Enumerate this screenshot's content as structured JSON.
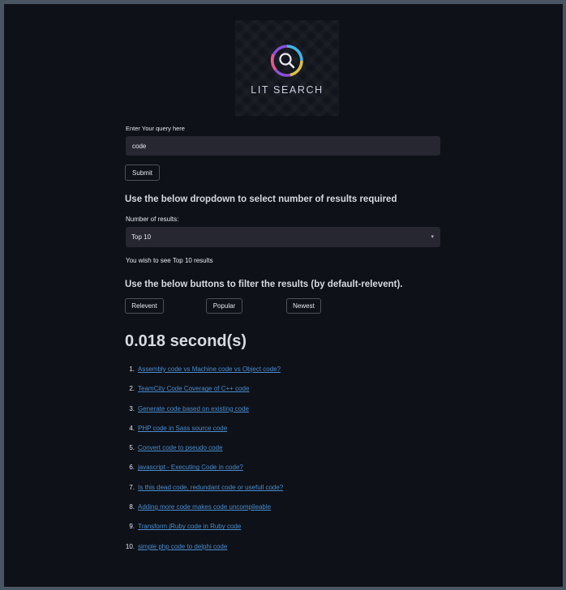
{
  "logo": {
    "text": "LIT SEARCH",
    "icon": "magnifier-icon"
  },
  "query": {
    "label": "Enter Your query here",
    "value": "code"
  },
  "submit_label": "Submit",
  "dropdown_heading": "Use the below dropdown to select number of results required",
  "results_count": {
    "label": "Number of results:",
    "selected": "Top 10"
  },
  "info_text": "You wish to see Top 10 results",
  "filter_heading": "Use the below buttons to filter the results (by default-relevent).",
  "filters": {
    "relevent": "Relevent",
    "popular": "Popular",
    "newest": "Newest"
  },
  "time_text": "0.018 second(s)",
  "results": [
    {
      "num": "1.",
      "title": "Assembly code vs Machine code vs Object code?"
    },
    {
      "num": "2.",
      "title": "TeamCity Code Coverage of C++ code"
    },
    {
      "num": "3.",
      "title": "Generate code based on existing code"
    },
    {
      "num": "4.",
      "title": "PHP code in Sass source code"
    },
    {
      "num": "5.",
      "title": "Convert code to pseudo code"
    },
    {
      "num": "6.",
      "title": "javascript - Executing Code in code?"
    },
    {
      "num": "7.",
      "title": "Is this dead code, redundant code or usefull code?"
    },
    {
      "num": "8.",
      "title": "Adding more code makes code uncompileable"
    },
    {
      "num": "9.",
      "title": "Transform jRuby code in Ruby code"
    },
    {
      "num": "10.",
      "title": "simple php code to delphi code"
    }
  ],
  "colors": {
    "background": "#0e1117",
    "input_background": "#262730",
    "link": "#4a8ccf",
    "text": "#e6e9ef"
  }
}
